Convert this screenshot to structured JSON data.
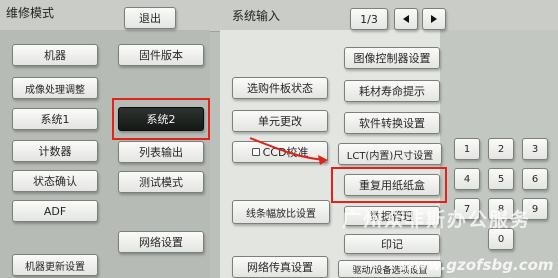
{
  "header": {
    "title": "维修模式",
    "exit_label": "退出",
    "section_title": "系统输入",
    "page_indicator": "1/3",
    "prev_icon": "left-triangle-icon",
    "next_icon": "right-triangle-icon"
  },
  "left_menu": {
    "col1": [
      "机器",
      "成像处理调整",
      "系统1",
      "计数器",
      "状态确认",
      "ADF",
      "机器更新设置"
    ],
    "col2": [
      "固件版本",
      "系统2",
      "列表输出",
      "测试模式",
      "网络设置"
    ],
    "selected": "系统2"
  },
  "center": {
    "buttons": [
      "选购件板状态",
      "单元更改",
      "CCD校准",
      "线条幅放比设置",
      "网络传真设置"
    ],
    "right_buttons": [
      "图像控制器设置",
      "耗材寿命提示",
      "软件转换设置",
      "LCT(内置)尺寸设置",
      "重复用纸纸盒",
      "数据管理",
      "印记",
      "驱动/设备选项设置"
    ]
  },
  "keypad": {
    "keys": [
      "1",
      "2",
      "3",
      "4",
      "5",
      "6",
      "7",
      "8",
      "9",
      "0"
    ]
  },
  "annotation": {
    "highlight_color": "#e2231a"
  },
  "watermark": {
    "text": "广州众非斯办公服务",
    "url": "www.gzofsbg.com"
  }
}
